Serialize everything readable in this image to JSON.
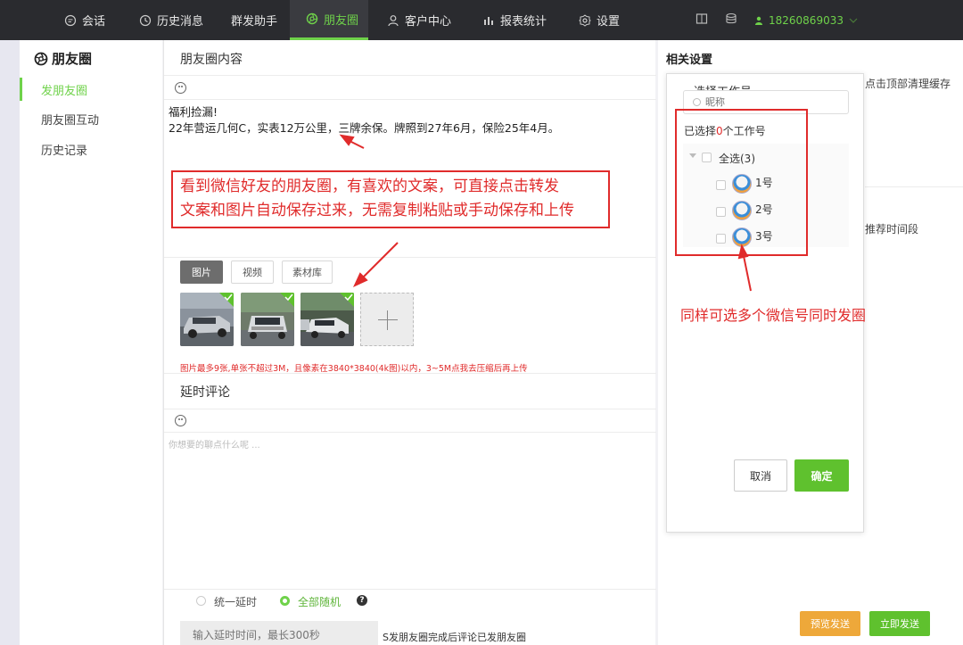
{
  "nav": {
    "items": [
      {
        "label": "会话",
        "icon": "chat-icon"
      },
      {
        "label": "历史消息",
        "icon": "clock-icon"
      },
      {
        "label": "群发助手",
        "icon": ""
      },
      {
        "label": "朋友圈",
        "icon": "moments-icon"
      },
      {
        "label": "客户中心",
        "icon": "user-icon"
      },
      {
        "label": "报表统计",
        "icon": "bar-chart-icon"
      },
      {
        "label": "设置",
        "icon": "gear-icon"
      }
    ],
    "active_index": 3,
    "phone": "18260869033",
    "accent": "#6fd24a"
  },
  "sidebar": {
    "title": "朋友圈",
    "items": [
      {
        "label": "发朋友圈",
        "active": true
      },
      {
        "label": "朋友圈互动",
        "active": false
      },
      {
        "label": "历史记录",
        "active": false
      }
    ]
  },
  "main": {
    "content_title": "朋友圈内容",
    "post_lines": [
      "福利捡漏!",
      "22年营运几何C，实表12万公里，三牌余保。牌照到27年6月，保险25年4月。"
    ],
    "callout_lines": [
      "看到微信好友的朋友圈，有喜欢的文案，可直接点击转发",
      "文案和图片自动保存过来，无需复制粘贴或手动保存和上传"
    ],
    "media_tabs": [
      "图片",
      "视频",
      "素材库"
    ],
    "image_hint": "图片最多9张,单张不超过3M，且像素在3840*3840(4k图)以内，3~5M点我去压缩后再上传",
    "delay_title": "延时评论",
    "comment_placeholder": "你想要的聊点什么呢 ...",
    "radio_options": [
      "统一延时",
      "全部随机"
    ],
    "radio_selected": 1,
    "delay_input_placeholder": "输入延时时间，最长300秒",
    "delay_note": "S发朋友圈完成后评论已发朋友圈"
  },
  "right": {
    "title": "相关设置",
    "frag_top": "点击顶部清理缓存",
    "frag_mid": "推荐时间段",
    "preview_btn": "预览发送",
    "send_btn": "立即发送"
  },
  "popup": {
    "title": "选择工作号",
    "search_placeholder": "昵称",
    "selected_prefix": "已选择",
    "selected_count": "0",
    "selected_suffix": "个工作号",
    "select_all": "全选(3)",
    "accounts": [
      "1号",
      "2号",
      "3号"
    ],
    "cancel": "取消",
    "ok": "确定"
  },
  "annotation": {
    "text": "同样可选多个微信号同时发圈",
    "color": "#e02b2b"
  }
}
